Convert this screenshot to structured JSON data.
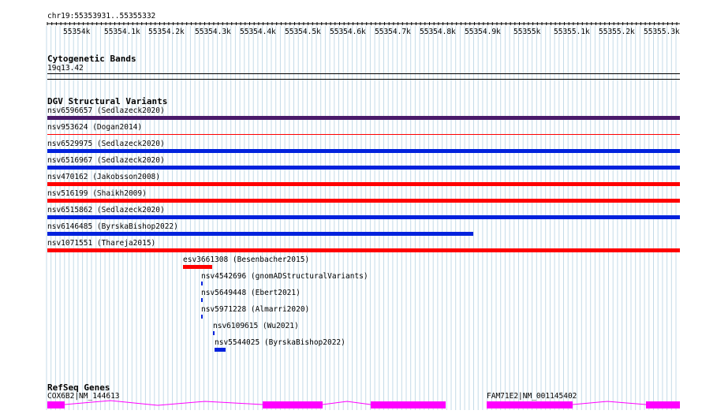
{
  "ruler": {
    "location": "chr19:55353931..55355332",
    "ticks": [
      "55354k",
      "55354.1k",
      "55354.2k",
      "55354.3k",
      "55354.4k",
      "55354.5k",
      "55354.6k",
      "55354.7k",
      "55354.8k",
      "55354.9k",
      "55355k",
      "55355.1k",
      "55355.2k",
      "55355.3k"
    ]
  },
  "cytoband": {
    "title": "Cytogenetic Bands",
    "band": "19q13.42"
  },
  "dgv": {
    "title": "DGV Structural Variants",
    "features": [
      {
        "label": "nsv6596657 (Sedlazeck2020)",
        "color": "#4a1a6a"
      },
      {
        "label": "nsv953624 (Dogan2014)",
        "color": "#ff0000"
      },
      {
        "label": "nsv6529975 (Sedlazeck2020)",
        "color": "#0022dd"
      },
      {
        "label": "nsv6516967 (Sedlazeck2020)",
        "color": "#0022dd"
      },
      {
        "label": "nsv470162 (Jakobsson2008)",
        "color": "#ff0000"
      },
      {
        "label": "nsv516199 (Shaikh2009)",
        "color": "#ff0000"
      },
      {
        "label": "nsv6515862 (Sedlazeck2020)",
        "color": "#0022dd"
      },
      {
        "label": "nsv6146485 (ByrskaBishop2022)",
        "color": "#0022dd"
      },
      {
        "label": "nsv1071551 (Thareja2015)",
        "color": "#ff0000"
      },
      {
        "label": "esv3661308 (Besenbacher2015)",
        "color": "#ff0000"
      },
      {
        "label": "nsv4542696 (gnomADStructuralVariants)",
        "color": "#0022dd"
      },
      {
        "label": "nsv5649448 (Ebert2021)",
        "color": "#0022dd"
      },
      {
        "label": "nsv5971228 (Almarri2020)",
        "color": "#0022dd"
      },
      {
        "label": "nsv6109615 (Wu2021)",
        "color": "#0022dd"
      },
      {
        "label": "nsv5544025 (ByrskaBishop2022)",
        "color": "#0022dd"
      }
    ]
  },
  "refseq": {
    "title": "RefSeq Genes",
    "genes": [
      {
        "label": "COX6B2|NM_144613",
        "color": "#ff00ff"
      },
      {
        "label": "FAM71E2|NM_001145402",
        "color": "#ff00ff"
      }
    ]
  }
}
